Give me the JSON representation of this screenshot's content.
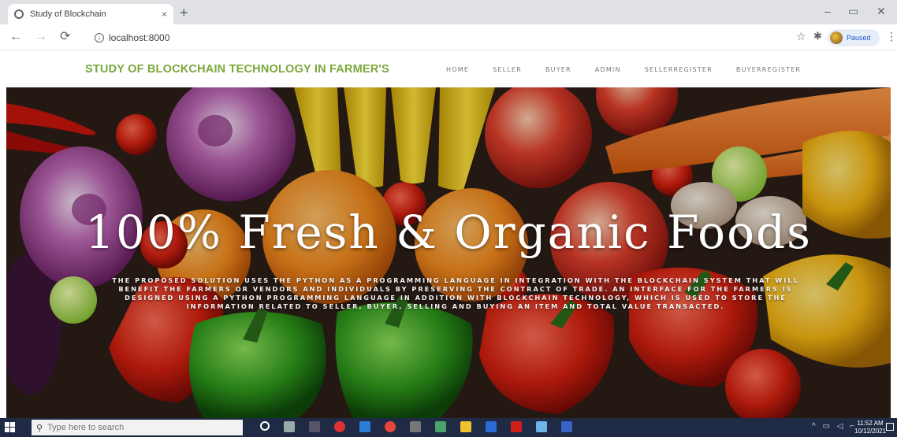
{
  "browser": {
    "tab_title": "Study of Blockchain",
    "tab_close": "×",
    "new_tab": "+",
    "url": "localhost:8000",
    "profile_status": "Paused"
  },
  "site": {
    "brand": "STUDY OF BLOCKCHAIN TECHNOLOGY IN FARMER'S",
    "brand_color": "#7aa83a",
    "menu": [
      {
        "label": "HOME"
      },
      {
        "label": "SELLER"
      },
      {
        "label": "BUYER"
      },
      {
        "label": "ADMIN"
      },
      {
        "label": "SELLERREGISTER"
      },
      {
        "label": "BUYERREGISTER"
      }
    ]
  },
  "hero": {
    "title": "100% Fresh & Organic Foods",
    "description": "The proposed solution uses the python as a programming language in integration with the blockchain system that will benefit the farmers or vendors and individuals by preserving the contract of trade. An interface for the farmers is designed using a python programming language in addition with blockchain technology, which is used to store the information related to seller, buyer, selling and buying an item and total value transacted."
  },
  "taskbar": {
    "search_placeholder": "Type here to search",
    "time": "11:52 AM",
    "date": "10/12/2021"
  },
  "icons": {
    "back": "arrow-left-icon",
    "forward": "arrow-right-icon",
    "reload": "reload-icon",
    "site_info": "info-icon",
    "bookmark": "star-icon",
    "extensions": "puzzle-icon",
    "menu": "kebab-icon"
  }
}
